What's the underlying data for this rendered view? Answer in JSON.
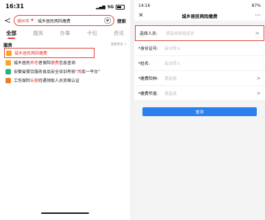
{
  "left": {
    "status": {
      "time": "16:31",
      "network": "5G"
    },
    "search": {
      "city": "宿州市",
      "query": "城乡居民两险缴费",
      "button": "搜索"
    },
    "tabs": [
      "全部",
      "服务",
      "办事",
      "卡包",
      "资讯"
    ],
    "section": {
      "title": "服务",
      "more": "查看更多 >"
    },
    "services": [
      {
        "label": "城乡居民两险缴费",
        "color": "#f5a623",
        "highlighted": true
      },
      {
        "pre": "城乡居民",
        "hl1": "养老",
        "mid": "者保险",
        "hl2": "缴费",
        "post": "信息查询",
        "color": "#f5a623"
      },
      {
        "pre": "安徽省餐饮服务食品安全培训考核“",
        "hl1": "两",
        "post": "库一平台”",
        "color": "#27b27a"
      },
      {
        "pre": "工伤保险",
        "hl1": "长期",
        "post": "待遇领取人员资格认证",
        "color": "#f07b2b"
      }
    ]
  },
  "right": {
    "status": {
      "time": "14:16",
      "battery": "87%"
    },
    "title": "城乡居民两险缴费",
    "fields": [
      {
        "label": "选择人员:",
        "placeholder": "请选择家庭成员",
        "chevron": true,
        "selected": true
      },
      {
        "label": "*身份证号:",
        "placeholder": "自动带入",
        "chevron": false
      },
      {
        "label": "*姓名:",
        "placeholder": "自动带入",
        "chevron": false
      },
      {
        "label": "*缴费险种:",
        "placeholder": "请选择",
        "chevron": true
      },
      {
        "label": "*缴费年度:",
        "placeholder": "请选择",
        "chevron": true
      }
    ],
    "query_button": "查询"
  }
}
